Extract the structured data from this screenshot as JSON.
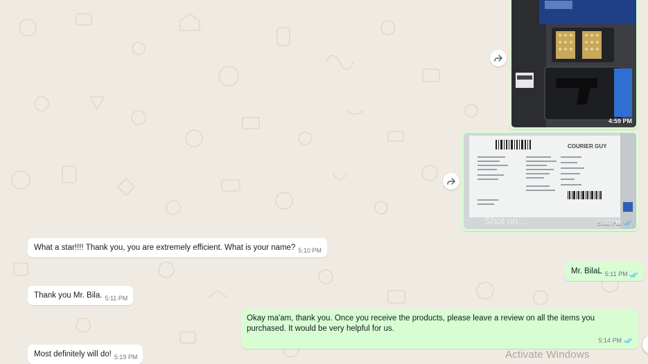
{
  "messages": [
    {
      "id": "m1",
      "type": "image",
      "direction": "out",
      "time": "4:59 PM",
      "status": "read",
      "content": "photo of items in case"
    },
    {
      "id": "m2",
      "type": "image",
      "direction": "out",
      "time": "5:00 PM",
      "status": "read",
      "content": "photo of courier shipping label",
      "overlay_text": "Shot on ...",
      "label_brand": "COURIER GUY"
    },
    {
      "id": "m3",
      "type": "text",
      "direction": "in",
      "text": "What a star!!!! Thank you, you are extremely efficient. What is your name?",
      "time": "5:10 PM"
    },
    {
      "id": "m4",
      "type": "text",
      "direction": "out",
      "text": "Mr. BilaL",
      "time": "5:11 PM",
      "status": "read"
    },
    {
      "id": "m5",
      "type": "text",
      "direction": "in",
      "text": "Thank you Mr. Bila.",
      "time": "5:11 PM"
    },
    {
      "id": "m6",
      "type": "text",
      "direction": "out",
      "text": "Okay ma'am, thank you. Once you receive the products, please leave a review on all the items you purchased. It would be very helpful for us.",
      "time": "5:14 PM",
      "status": "read"
    },
    {
      "id": "m7",
      "type": "text",
      "direction": "in",
      "text": "Most definitely will do!",
      "time": "5:19 PM"
    }
  ],
  "watermark": "Activate Windows",
  "icons": {
    "forward": "forward-icon",
    "read_receipt": "double-check-icon"
  },
  "colors": {
    "background": "#efeae2",
    "incoming": "#ffffff",
    "outgoing": "#d9fdd3",
    "read_tick": "#53bdeb",
    "meta": "#667781"
  }
}
